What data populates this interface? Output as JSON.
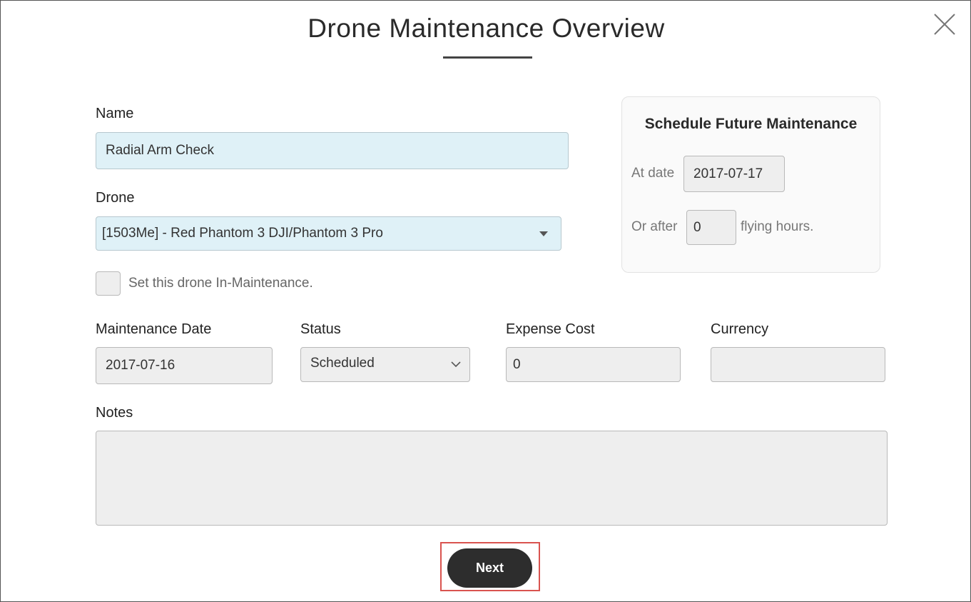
{
  "dialog": {
    "title": "Drone Maintenance Overview"
  },
  "form": {
    "name_label": "Name",
    "name_value": "Radial Arm Check",
    "drone_label": "Drone",
    "drone_value": "[1503Me] - Red Phantom 3 DJI/Phantom 3 Pro",
    "in_maintenance_label": "Set this drone In-Maintenance.",
    "maintenance_date_label": "Maintenance Date",
    "maintenance_date_value": "2017-07-16",
    "status_label": "Status",
    "status_value": "Scheduled",
    "expense_cost_label": "Expense Cost",
    "expense_cost_value": "0",
    "currency_label": "Currency",
    "currency_value": "",
    "notes_label": "Notes",
    "notes_value": ""
  },
  "schedule": {
    "title": "Schedule Future Maintenance",
    "at_date_label": "At date",
    "at_date_value": "2017-07-17",
    "or_after_label": "Or after",
    "hours_value": "0",
    "hours_suffix": "flying hours."
  },
  "actions": {
    "next_label": "Next"
  },
  "icons": {
    "close": "close-icon",
    "drone_dropdown": "caret-down-icon",
    "status_dropdown": "chevron-down-icon"
  },
  "colors": {
    "highlight_field": "#dff1f7",
    "button_bg": "#2d2d2d",
    "annotation_outline": "#d9534f"
  }
}
